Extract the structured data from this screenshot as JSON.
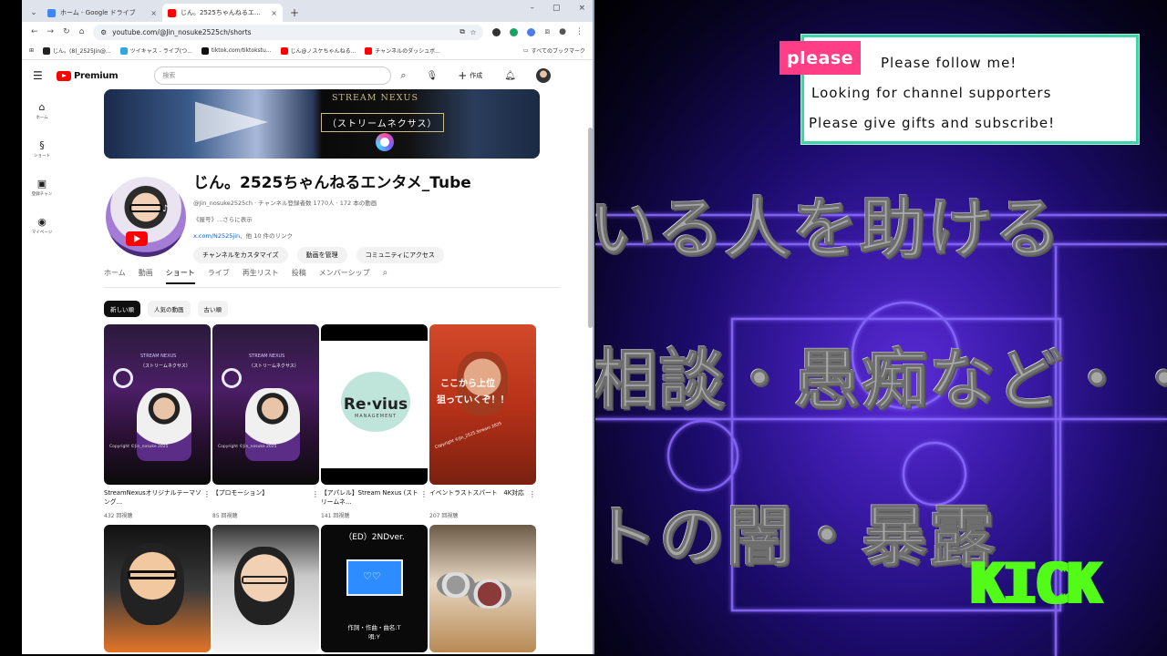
{
  "browser": {
    "tabs": [
      {
        "title": "ホーム - Google ドライブ",
        "close": "×",
        "favicon_color": "#4285f4",
        "active": false
      },
      {
        "title": "じん。2525ちゃんねるエンタメ_Tube",
        "close": "×",
        "favicon_color": "#ff0000",
        "active": true
      }
    ],
    "new_tab": "+",
    "window_controls": [
      "–",
      "▢",
      "×"
    ],
    "url": "youtube.com/@Jin_nosuke2525ch/shorts",
    "bookmarks": [
      {
        "label": "じん。(8)_2525Jin@...",
        "color": "#222222"
      },
      {
        "label": "ツイキャス - ライブ(つ...",
        "color": "#2fa8e0"
      },
      {
        "label": "tiktok.com/tiktokstu...",
        "color": "#111111"
      },
      {
        "label": "じん@ノスケちゃんねる...",
        "color": "#ff0000"
      },
      {
        "label": "チャンネルのダッシュボ...",
        "color": "#ff0000"
      }
    ],
    "bookmarks_all": "すべてのブックマーク"
  },
  "youtube": {
    "logo_text": "Premium",
    "search_placeholder": "検索",
    "create_label": "作成",
    "sidebar": [
      {
        "icon": "home-icon",
        "glyph": "⌂",
        "label": "ホーム"
      },
      {
        "icon": "shorts-icon",
        "glyph": "§",
        "label": "ショート"
      },
      {
        "icon": "subscriptions-icon",
        "glyph": "▣",
        "label": "登録チャン"
      },
      {
        "icon": "profile-icon",
        "glyph": "◉",
        "label": "マイページ"
      }
    ],
    "banner": {
      "title_en": "STREAM NEXUS",
      "title_jp": "（ストリームネクサス）"
    },
    "channel": {
      "name": "じん。2525ちゃんねるエンタメ_Tube",
      "meta": "@Jin_nosuke2525ch · チャンネル登録者数 1770人 · 172 本の動画",
      "desc_prefix": "《屋号》",
      "desc_more": "...さらに表示",
      "link": "x.com/N2525jin",
      "link_suffix": "、他 10 件のリンク",
      "buttons": [
        "チャンネルをカスタマイズ",
        "動画を管理",
        "コミュニティにアクセス"
      ]
    },
    "tabs": [
      "ホーム",
      "動画",
      "ショート",
      "ライブ",
      "再生リスト",
      "投稿",
      "メンバーシップ"
    ],
    "active_tab": "ショート",
    "chips": [
      "新しい順",
      "人気の動画",
      "古い順"
    ],
    "shorts": [
      {
        "title": "StreamNexusオリジナルテーマソング...",
        "views": "432 回視聴",
        "thumb_text": [
          "STREAM NEXUS",
          "（ストリームネクサス）",
          "Copyright ©Jin_nosuke 2025"
        ]
      },
      {
        "title": "【プロモーション】",
        "views": "85 回視聴",
        "thumb_text": [
          "STREAM NEXUS",
          "（ストリームネクサス）",
          "Copyright ©Jin_nosuke 2025"
        ]
      },
      {
        "title": "【アパレル】Stream Nexus (ストリームネ...",
        "views": "141 回視聴",
        "thumb_text": [
          "Re·vius",
          "MANAGEMENT"
        ]
      },
      {
        "title": "イベントラストスパート　4K対応",
        "views": "207 回視聴",
        "thumb_text": [
          "ここから上位",
          "狙っていくぞ！！",
          "Copyright ©Jin_2525.Stream 2025"
        ]
      },
      {
        "title": "",
        "views": "",
        "thumb_text": []
      },
      {
        "title": "",
        "views": "",
        "thumb_text": []
      },
      {
        "title": "",
        "views": "",
        "thumb_text": [
          "（ED）2NDver.",
          "作詞・作曲・曲名:T",
          "唄:Y"
        ]
      },
      {
        "title": "",
        "views": "",
        "thumb_text": []
      }
    ]
  },
  "stream_overlay": {
    "badge": "please",
    "lines": [
      "Please follow me!",
      "Looking for channel supporters",
      "Please give gifts and subscribe!"
    ],
    "background_text": [
      "いる人を助ける",
      "相談・愚痴など・・・",
      "トの闇・暴露"
    ],
    "kick": "KICK",
    "colors": {
      "badge": "#ff3e86",
      "border": "#3ed6a8",
      "kick": "#53fc18",
      "accent": "#6a3cff"
    }
  }
}
